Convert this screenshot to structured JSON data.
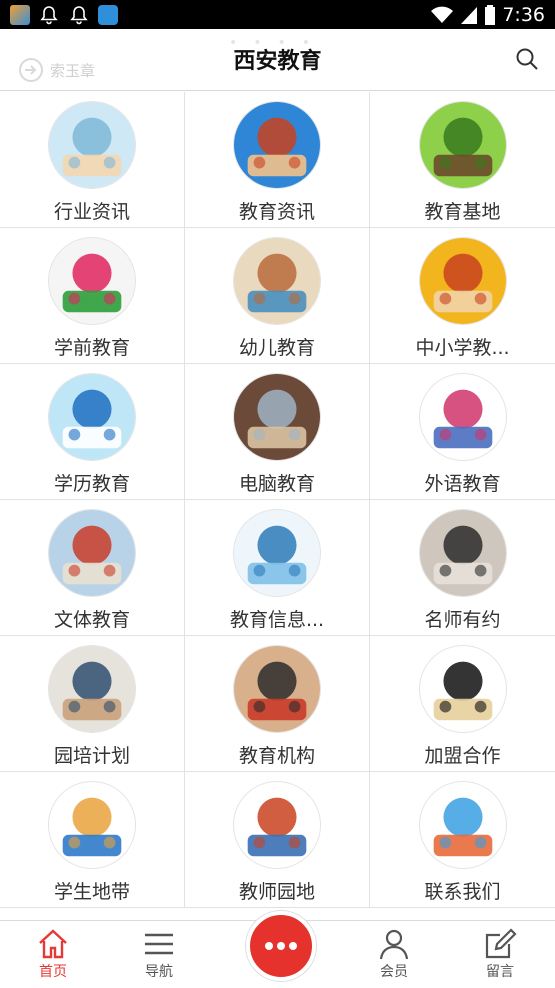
{
  "status_bar": {
    "time": "7:36",
    "icons": [
      "app-icon",
      "bell-icon",
      "bell-icon",
      "app-icon",
      "wifi-icon",
      "signal-icon",
      "battery-icon"
    ]
  },
  "header": {
    "title": "西安教育",
    "faded_text": "索玉章",
    "search_icon": "search-icon"
  },
  "grid": [
    {
      "label": "行业资讯",
      "icon": "family-photo",
      "colors": [
        "#cfe8f6",
        "#7fb8d8",
        "#f4d6b0"
      ]
    },
    {
      "label": "教育资讯",
      "icon": "teacher-photo",
      "colors": [
        "#2f86d6",
        "#c9421f",
        "#f3c18a"
      ]
    },
    {
      "label": "教育基地",
      "icon": "tree-cartoon",
      "colors": [
        "#8fd04a",
        "#3a7a1e",
        "#6b4a2a"
      ]
    },
    {
      "label": "学前教育",
      "icon": "hand-logo",
      "colors": [
        "#f5f5f5",
        "#e0245e",
        "#2d9f3a"
      ]
    },
    {
      "label": "幼儿教育",
      "icon": "child-reading",
      "colors": [
        "#e9d9bf",
        "#b86b3a",
        "#4a8fbf"
      ]
    },
    {
      "label": "中小学教...",
      "icon": "students-photo",
      "colors": [
        "#f2b51d",
        "#c9421f",
        "#f1d3a8"
      ]
    },
    {
      "label": "学历教育",
      "icon": "diploma-banner",
      "colors": [
        "#bfe6f7",
        "#1d6fc1",
        "#ffffff"
      ]
    },
    {
      "label": "电脑教育",
      "icon": "computer-class",
      "colors": [
        "#6b4a3a",
        "#9fb4c6",
        "#d9c2a2"
      ]
    },
    {
      "label": "外语教育",
      "icon": "language-banner",
      "colors": [
        "#ffffff",
        "#d0336b",
        "#4a6fbf"
      ]
    },
    {
      "label": "文体教育",
      "icon": "sports-photo",
      "colors": [
        "#b8d3e8",
        "#c93c2a",
        "#e8e0d0"
      ]
    },
    {
      "label": "教育信息...",
      "icon": "globe-network",
      "colors": [
        "#eef6fb",
        "#2c7ab9",
        "#7fc1e8"
      ]
    },
    {
      "label": "名师有约",
      "icon": "teachers-meeting",
      "colors": [
        "#cfc7bd",
        "#2b2b2b",
        "#e6e0d8"
      ]
    },
    {
      "label": "园培计划",
      "icon": "training-photo",
      "colors": [
        "#e6e3dc",
        "#2f4e6e",
        "#c9a27a"
      ]
    },
    {
      "label": "教育机构",
      "icon": "institution-photo",
      "colors": [
        "#d9b08c",
        "#2b2b2b",
        "#c93c2a"
      ]
    },
    {
      "label": "加盟合作",
      "icon": "graduation-cap",
      "colors": [
        "#ffffff",
        "#111111",
        "#e6cf9a"
      ]
    },
    {
      "label": "学生地带",
      "icon": "students-cartoon",
      "colors": [
        "#ffffff",
        "#e8a23b",
        "#2f7ac9"
      ]
    },
    {
      "label": "教师园地",
      "icon": "books-stack",
      "colors": [
        "#ffffff",
        "#c9421f",
        "#3b6fb5"
      ]
    },
    {
      "label": "联系我们",
      "icon": "child-laptop",
      "colors": [
        "#ffffff",
        "#3a9fe0",
        "#e86a3b"
      ]
    }
  ],
  "bottom_nav": {
    "tabs": [
      {
        "label": "首页",
        "icon": "home-icon",
        "active": true
      },
      {
        "label": "导航",
        "icon": "menu-icon",
        "active": false
      },
      {
        "label": "会员",
        "icon": "user-icon",
        "active": false
      },
      {
        "label": "留言",
        "icon": "edit-icon",
        "active": false
      }
    ],
    "center_icon": "more-icon",
    "accent_color": "#e53935"
  }
}
